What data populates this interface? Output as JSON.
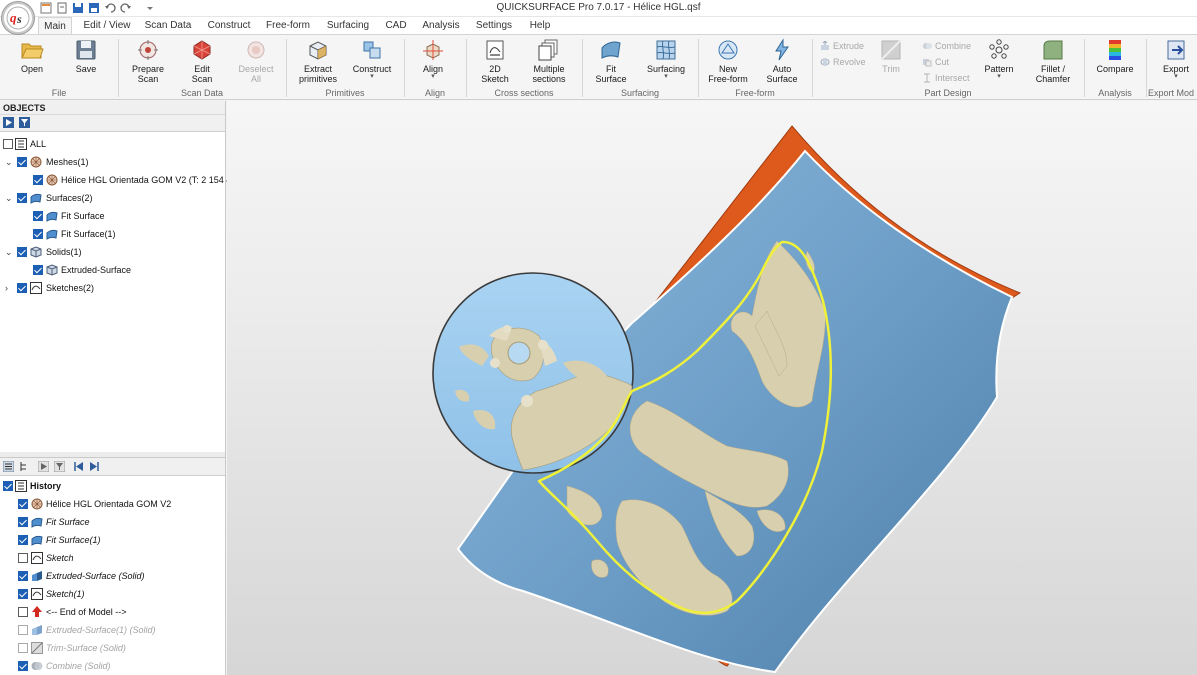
{
  "window": {
    "title": "QUICKSURFACE Pro 7.0.17 - Hélice HGL.qsf"
  },
  "menu": {
    "tabs": [
      "Main",
      "Edit / View",
      "Scan Data",
      "Construct",
      "Free-form",
      "Surfacing",
      "CAD",
      "Analysis",
      "Settings",
      "Help"
    ],
    "active": "Main"
  },
  "ribbon": {
    "open": "Open",
    "save": "Save",
    "group_file": "File",
    "prepare_scan_1": "Prepare",
    "prepare_scan_2": "Scan",
    "edit_scan_1": "Edit",
    "edit_scan_2": "Scan",
    "deselect_1": "Deselect",
    "deselect_2": "All",
    "group_scan_data": "Scan Data",
    "extract_1": "Extract",
    "extract_2": "primitives",
    "construct": "Construct",
    "group_primitives": "Primitives",
    "align": "Align",
    "group_align": "Align",
    "sketch2d_1": "2D",
    "sketch2d_2": "Sketch",
    "multiple_1": "Multiple",
    "multiple_2": "sections",
    "group_cross": "Cross sections",
    "fit_surface_1": "Fit",
    "fit_surface_2": "Surface",
    "surfacing": "Surfacing",
    "group_surfacing": "Surfacing",
    "new_freeform_1": "New",
    "new_freeform_2": "Free-form",
    "auto_surface_1": "Auto",
    "auto_surface_2": "Surface",
    "group_freeform": "Free-form",
    "extrude": "Extrude",
    "revolve": "Revolve",
    "trim": "Trim",
    "combine": "Combine",
    "cut": "Cut",
    "intersect": "Intersect",
    "pattern": "Pattern",
    "fillet_1": "Fillet /",
    "fillet_2": "Chamfer",
    "group_part_design": "Part Design",
    "compare": "Compare",
    "group_analysis": "Analysis",
    "export": "Export",
    "group_export": "Export Mod"
  },
  "objects": {
    "header": "OBJECTS",
    "all": "ALL",
    "meshes": "Meshes(1)",
    "mesh_item": "Hélice HGL Orientada GOM V2 (T: 2 154 4",
    "surfaces": "Surfaces(2)",
    "surface_1": "Fit Surface",
    "surface_2": "Fit Surface(1)",
    "solids": "Solids(1)",
    "solid_1": "Extruded-Surface",
    "sketches": "Sketches(2)"
  },
  "history": {
    "header": "History",
    "items": [
      "Hélice HGL Orientada GOM V2",
      "Fit Surface",
      "Fit Surface(1)",
      "Sketch",
      "Extruded-Surface (Solid)",
      "Sketch(1)",
      "<-- End of Model -->",
      "Extruded-Surface(1) (Solid)",
      "Trim-Surface (Solid)",
      "Combine (Solid)"
    ]
  },
  "colors": {
    "surface_blue": "#6fa4cf",
    "surface_orange": "#dd5a1c",
    "mesh_beige": "#d8cfae",
    "sketch_yellow": "#f0f03a",
    "checkbox_blue": "#1d5fb4"
  }
}
